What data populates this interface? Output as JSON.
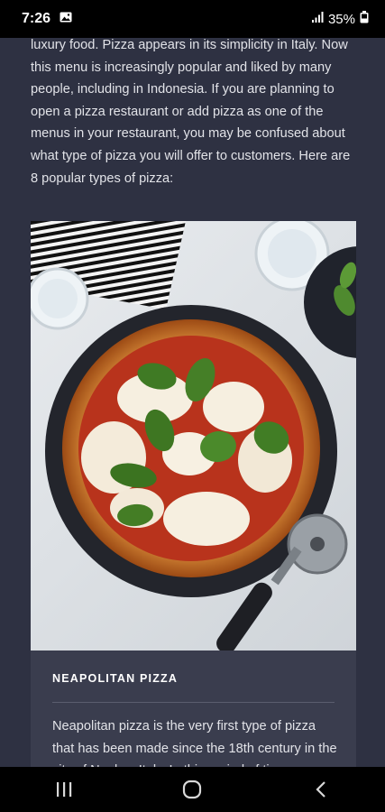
{
  "status": {
    "time": "7:26",
    "battery": "35%"
  },
  "intro_text": "luxury food. Pizza appears in its simplicity in Italy. Now this menu is increasingly popular and liked by many people, including in Indonesia. If you are planning to open a pizza restaurant or add pizza as one of the menus in your restaurant, you may be confused about what type of pizza you will offer to customers. Here are 8 popular types of pizza:",
  "card": {
    "title": "NEAPOLITAN PIZZA",
    "body": "Neapolitan pizza is the very first type of pizza that has been made since the 18th century in the city of Naples, Italy. In this period of time"
  },
  "icons": {
    "gallery": "image-icon",
    "signal": "signal-icon",
    "battery": "battery-icon",
    "recents": "recents-icon",
    "home": "home-icon",
    "back": "back-icon"
  }
}
